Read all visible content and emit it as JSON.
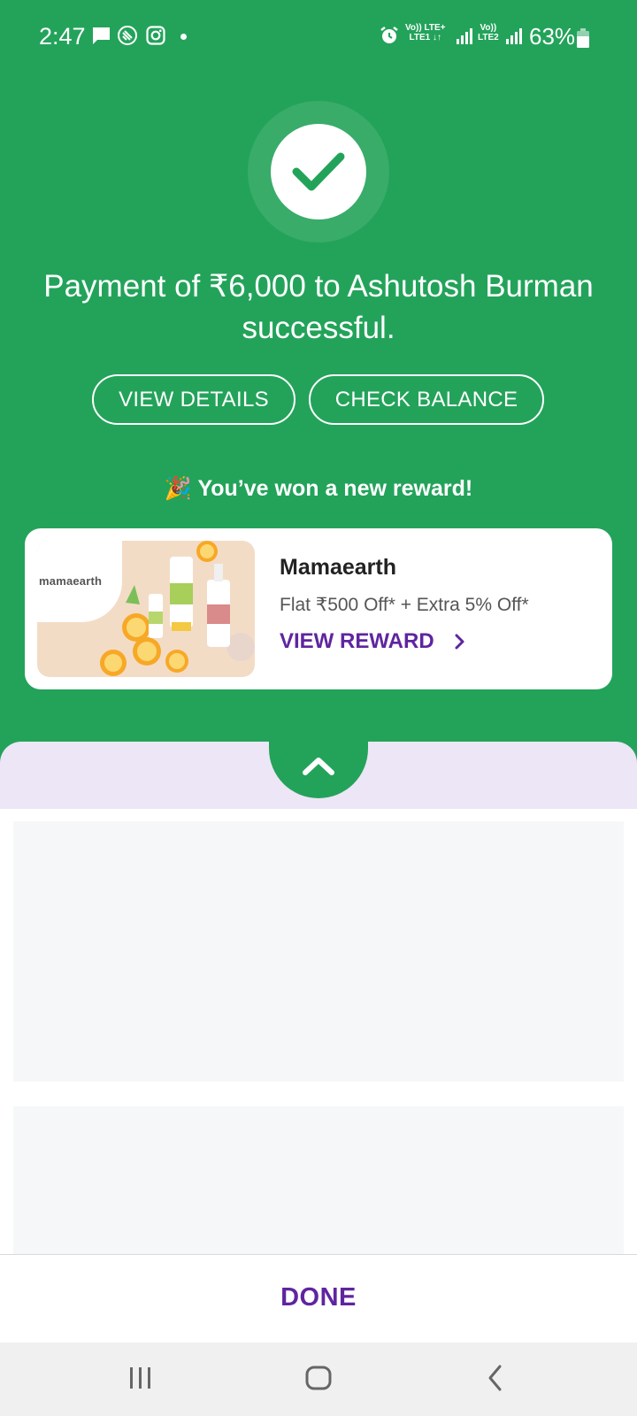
{
  "status_bar": {
    "time": "2:47",
    "sim1_top": "Vo)) LTE+",
    "sim1_bottom": "LTE1 ↓↑",
    "sim2_top": "Vo))",
    "sim2_bottom": "LTE2",
    "battery_percent": "63%"
  },
  "payment": {
    "message": "Payment of ₹6,000 to Ashutosh Burman successful.",
    "view_details_label": "VIEW DETAILS",
    "check_balance_label": "CHECK BALANCE"
  },
  "reward": {
    "headline": "🎉 You’ve won a new reward!",
    "brand_logo_text": "mamaearth",
    "title": "Mamaearth",
    "offer": "Flat ₹500 Off* + Extra 5% Off*",
    "cta_label": "VIEW REWARD"
  },
  "footer": {
    "done_label": "DONE"
  },
  "colors": {
    "primary_green": "#23a35a",
    "accent_purple": "#5f259f",
    "sheet_lavender": "#ece6f6"
  },
  "icons": [
    "message-icon",
    "stacked-app-icon",
    "instagram-icon",
    "alarm-icon",
    "signal-icon",
    "battery-icon",
    "check-icon",
    "chevron-right-icon",
    "chevron-up-icon",
    "recents-icon",
    "home-icon",
    "back-icon"
  ]
}
